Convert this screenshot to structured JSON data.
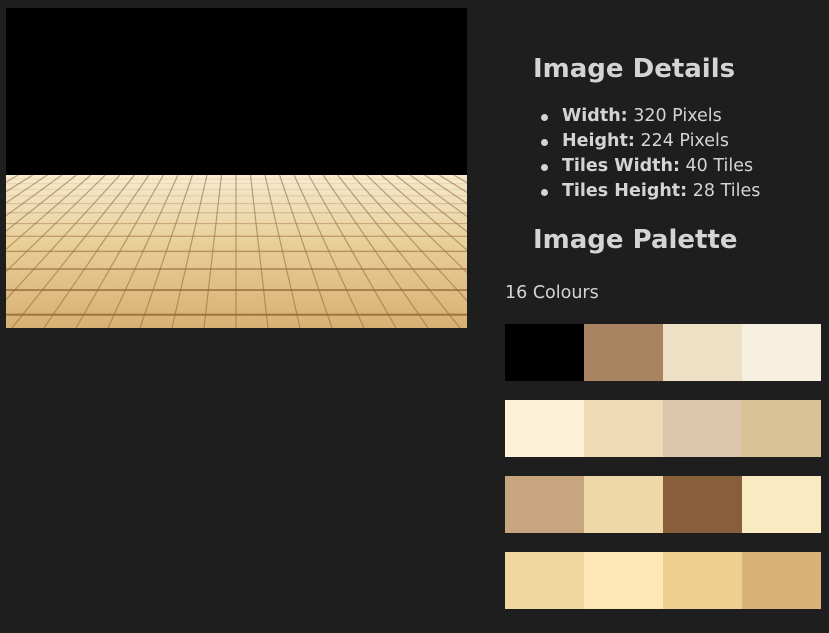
{
  "details": {
    "title": "Image Details",
    "items": [
      {
        "label": "Width:",
        "value": " 320 Pixels"
      },
      {
        "label": "Height:",
        "value": " 224 Pixels"
      },
      {
        "label": "Tiles Width:",
        "value": " 40 Tiles"
      },
      {
        "label": "Tiles Height:",
        "value": " 28 Tiles"
      }
    ]
  },
  "palette": {
    "title": "Image Palette",
    "count_text": "16 Colours",
    "colors": [
      "#000000",
      "#a88460",
      "#ede0c4",
      "#f6eedf",
      "#fcf1d6",
      "#eedab3",
      "#dec6ad",
      "#d9c293",
      "#c7a67f",
      "#eed8a8",
      "#895e3b",
      "#f9eac2",
      "#efd69f",
      "#fde8b5",
      "#eecf90",
      "#d8b278"
    ]
  },
  "preview": {
    "sky_color": "#000000",
    "floor_light": "#f6ead0",
    "floor_mid": "#e7cf98",
    "floor_dark": "#d8b074",
    "grout_color": "#9a6a3a"
  }
}
